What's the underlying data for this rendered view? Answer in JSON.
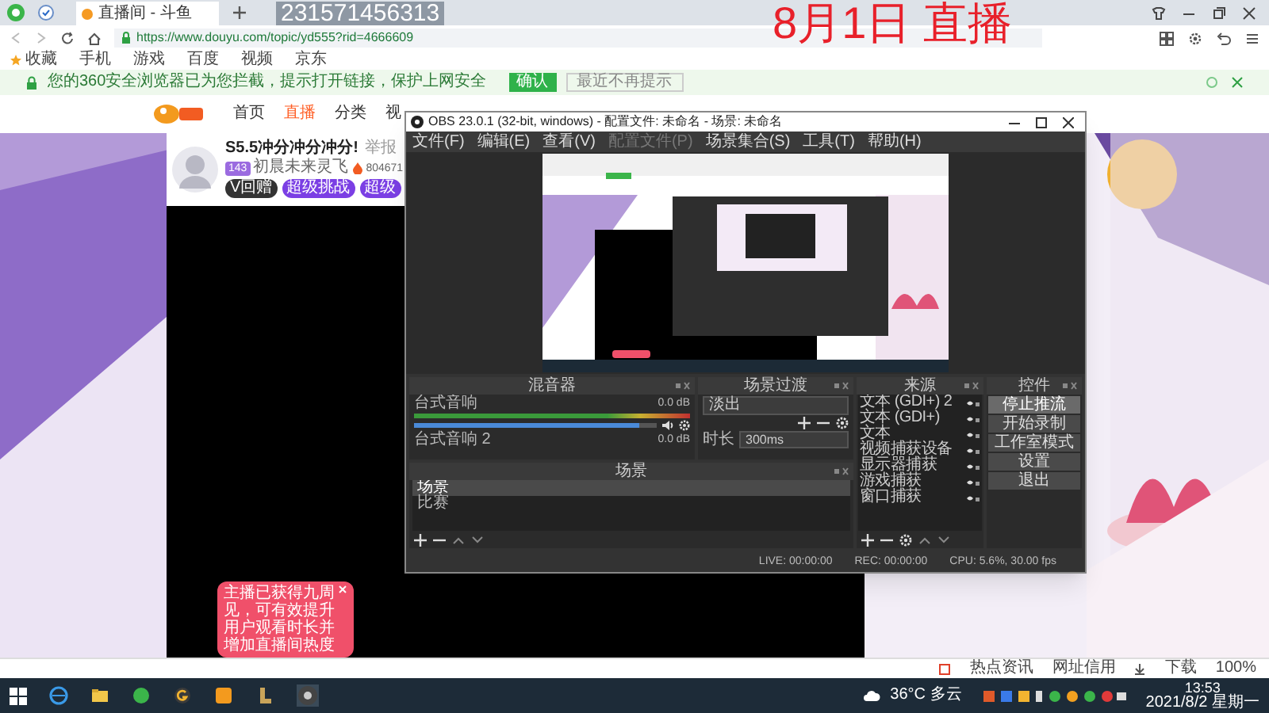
{
  "browser": {
    "tabs": [
      {
        "title": "直播间 - 斗鱼",
        "selected": true
      }
    ],
    "url": "https://www.douyu.com/topic/yd555?rid=4666609",
    "bookmarks": [
      "收藏",
      "手机",
      "游戏",
      "百度",
      "视频",
      "京东"
    ],
    "notice": {
      "text": "您的360安全浏览器已为您拦截，提示打开链接，保护上网安全",
      "confirm": "确认",
      "dismiss": "最近不再提示"
    },
    "status_bar": [
      "热点资讯",
      "网址信用",
      "下载",
      "100%"
    ]
  },
  "overlay": {
    "id_text": "231571456313",
    "caption": "8月1日 直播"
  },
  "site": {
    "nav": [
      {
        "label": "首页",
        "selected": false
      },
      {
        "label": "直播",
        "selected": true
      },
      {
        "label": "分类",
        "selected": false
      },
      {
        "label": "视",
        "selected": false
      }
    ],
    "stream": {
      "title": "S5.5冲分冲分冲分!",
      "report": "举报",
      "level": "143",
      "streamer": "初晨未来灵飞",
      "heat": "804671",
      "buttons": [
        "V回赠",
        "超级挑战",
        "超级"
      ]
    },
    "toast": "主播已获得九周见，可有效提升用户观看时长并增加直播间热度"
  },
  "obs": {
    "title": "OBS 23.0.1 (32-bit, windows) - 配置文件: 未命名 - 场景: 未命名",
    "menu": [
      {
        "label": "文件(F)",
        "disabled": false
      },
      {
        "label": "编辑(E)",
        "disabled": false
      },
      {
        "label": "查看(V)",
        "disabled": false
      },
      {
        "label": "配置文件(P)",
        "disabled": true
      },
      {
        "label": "场景集合(S)",
        "disabled": false
      },
      {
        "label": "工具(T)",
        "disabled": false
      },
      {
        "label": "帮助(H)",
        "disabled": false
      }
    ],
    "mixer": {
      "title": "混音器",
      "channels": [
        {
          "name": "台式音响",
          "reading": "0.0 dB",
          "level": 0.93
        },
        {
          "name": "台式音响 2",
          "reading": "0.0 dB"
        }
      ]
    },
    "transitions": {
      "title": "场景过渡",
      "transition": "淡出",
      "duration_label": "时长",
      "duration": "300ms"
    },
    "scenes": {
      "title": "场景",
      "items": [
        {
          "label": "场景",
          "selected": true
        },
        {
          "label": "比赛",
          "selected": false
        }
      ]
    },
    "sources": {
      "title": "来源",
      "items": [
        "文本 (GDI+) 2",
        "文本 (GDI+)",
        "文本",
        "视频捕获设备",
        "显示器捕获",
        "游戏捕获",
        "窗口捕获"
      ]
    },
    "controls": {
      "title": "控件",
      "buttons": [
        {
          "label": "停止推流",
          "active": true
        },
        {
          "label": "开始录制",
          "active": false
        },
        {
          "label": "工作室模式",
          "active": false
        },
        {
          "label": "设置",
          "active": false
        },
        {
          "label": "退出",
          "active": false
        }
      ]
    },
    "status": [
      "LIVE: 00:00:00",
      "REC: 00:00:00",
      "CPU: 5.6%, 30.00 fps"
    ]
  },
  "taskbar": {
    "weather": "36°C 多云",
    "time": "13:53",
    "date": "2021/8/2 星期一"
  }
}
